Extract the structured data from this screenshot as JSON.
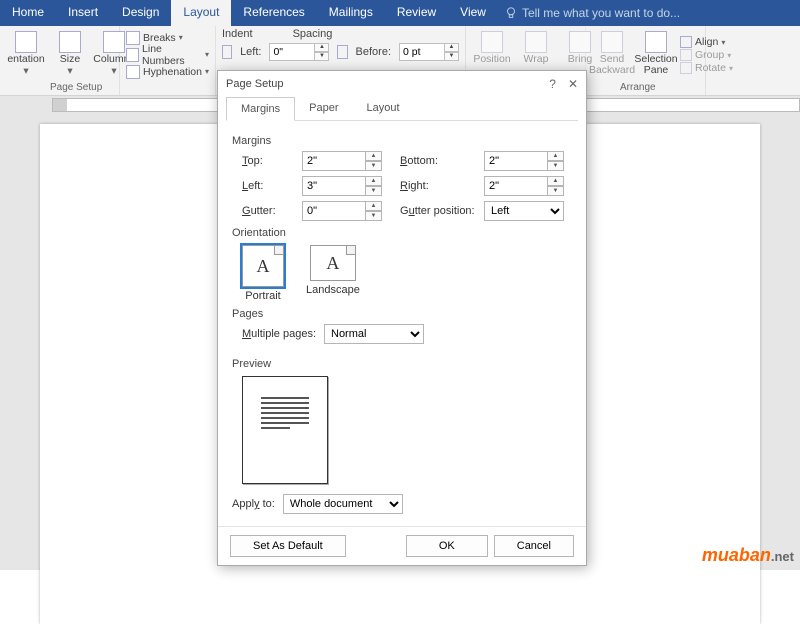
{
  "menu": {
    "tabs": [
      "Home",
      "Insert",
      "Design",
      "Layout",
      "References",
      "Mailings",
      "Review",
      "View"
    ],
    "active": "Layout",
    "tell_me": "Tell me what you want to do..."
  },
  "ribbon": {
    "orientation": "entation",
    "size": "Size",
    "columns": "Columns",
    "breaks": "Breaks",
    "line_numbers": "Line Numbers",
    "hyphenation": "Hyphenation",
    "page_setup_label": "Page Setup",
    "indent_label": "Indent",
    "spacing_label": "Spacing",
    "left_label": "Left:",
    "before_label": "Before:",
    "left_value": "0\"",
    "before_value": "0 pt",
    "position": "Position",
    "wrap": "Wrap",
    "bring": "Bring",
    "send_backward": "Send\nBackward",
    "selection_pane": "Selection\nPane",
    "align": "Align",
    "group": "Group",
    "rotate": "Rotate",
    "arrange_label": "Arrange"
  },
  "dialog": {
    "title": "Page Setup",
    "tabs": {
      "margins": "Margins",
      "paper": "Paper",
      "layout": "Layout"
    },
    "margins_section": "Margins",
    "top_label": "Top:",
    "top_value": "2\"",
    "bottom_label": "Bottom:",
    "bottom_value": "2\"",
    "left_label": "Left:",
    "left_value": "3\"",
    "right_label": "Right:",
    "right_value": "2\"",
    "gutter_label": "Gutter:",
    "gutter_value": "0\"",
    "gutter_pos_label": "Gutter position:",
    "gutter_pos_value": "Left",
    "orientation_section": "Orientation",
    "portrait": "Portrait",
    "landscape": "Landscape",
    "pages_section": "Pages",
    "multiple_pages_label": "Multiple pages:",
    "multiple_pages_value": "Normal",
    "preview_section": "Preview",
    "apply_to_label": "Apply to:",
    "apply_to_value": "Whole document",
    "set_default": "Set As Default",
    "ok": "OK",
    "cancel": "Cancel"
  },
  "watermark": {
    "brand": "muaban",
    "suffix": ".net"
  }
}
